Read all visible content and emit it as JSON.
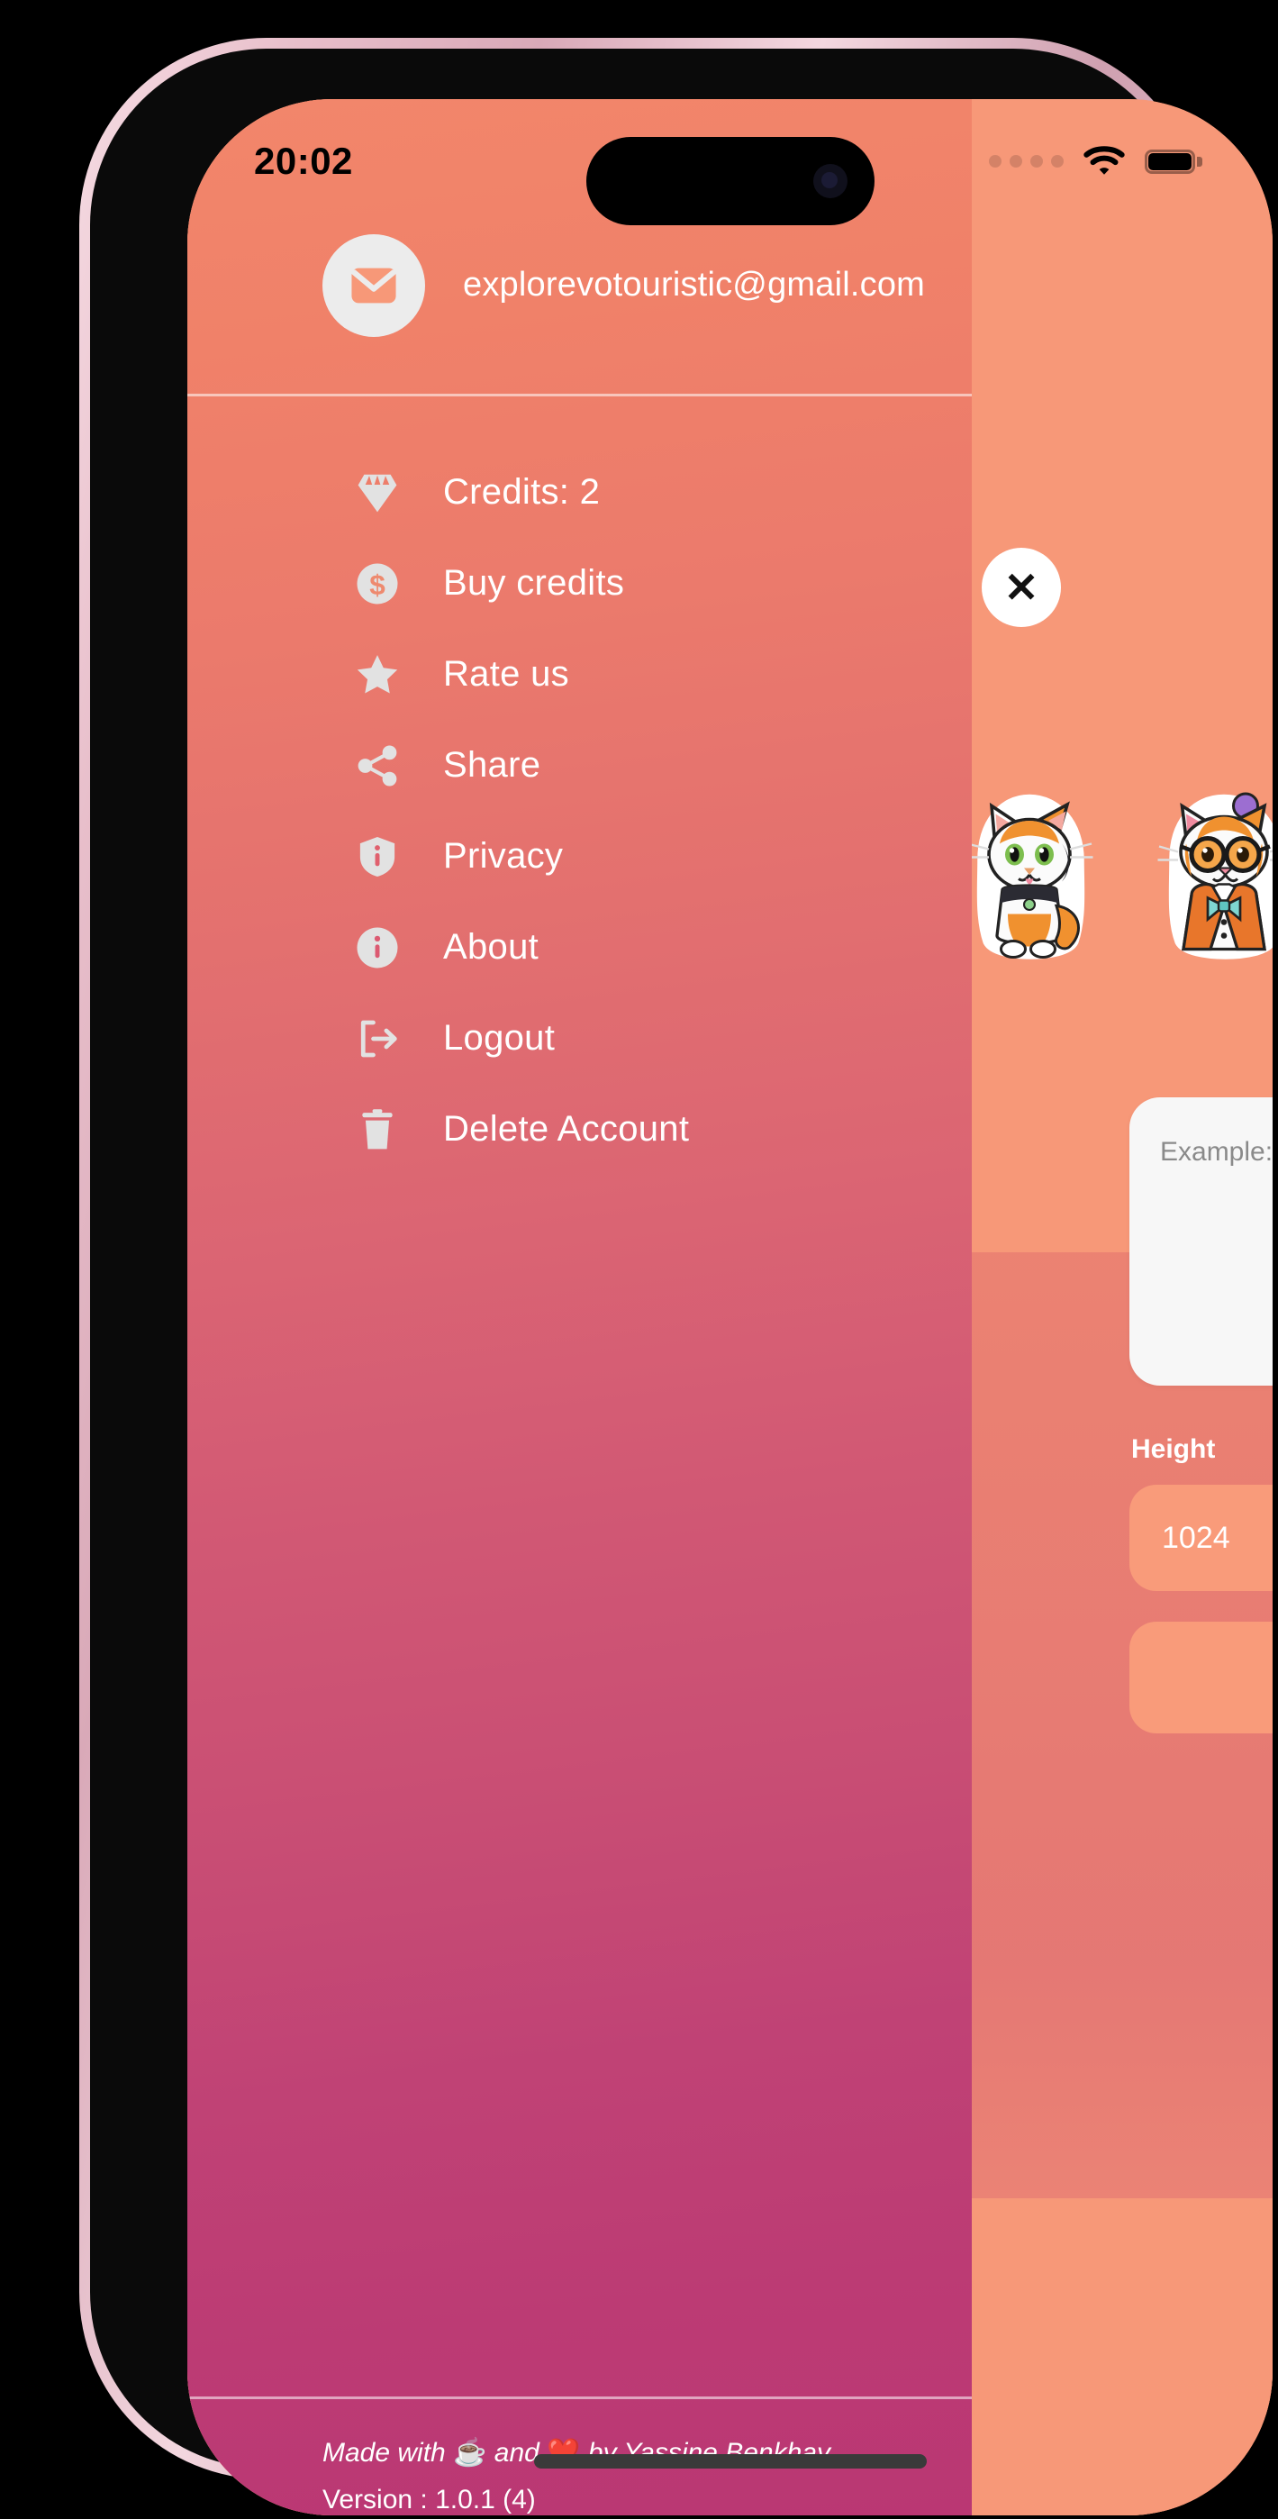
{
  "status_bar": {
    "time": "20:02",
    "signal_icon": "signal-dots-icon",
    "wifi_icon": "wifi-icon",
    "battery_icon": "battery-icon"
  },
  "drawer": {
    "account": {
      "avatar_icon": "envelope-icon",
      "email": "explorevotouristic@gmail.com"
    },
    "items": [
      {
        "label": "Credits: 2",
        "icon": "diamond-icon"
      },
      {
        "label": "Buy credits",
        "icon": "dollar-circle-icon"
      },
      {
        "label": "Rate us",
        "icon": "star-icon"
      },
      {
        "label": "Share",
        "icon": "share-icon"
      },
      {
        "label": "Privacy",
        "icon": "shield-info-icon"
      },
      {
        "label": "About",
        "icon": "info-circle-icon"
      },
      {
        "label": "Logout",
        "icon": "logout-icon"
      },
      {
        "label": "Delete Account",
        "icon": "trash-icon"
      }
    ],
    "footer": {
      "made_with_prefix": "Made with",
      "coffee_emoji": "☕",
      "made_with_middle": "and",
      "heart_emoji": "❤️",
      "made_with_suffix": "by Yassine Benkhay",
      "version": "Version : 1.0.1 (4)"
    }
  },
  "app_background": {
    "close_button_label": "✕",
    "stickers": [
      {
        "name": "calico-cat-sticker"
      },
      {
        "name": "cat-in-suit-with-glasses-sticker"
      }
    ],
    "prompt_input": {
      "placeholder": "Example: a cute p"
    },
    "height_field": {
      "label": "Height",
      "value": "1024"
    }
  },
  "colors": {
    "drawer_top": "#F2866B",
    "drawer_bottom": "#BA3773",
    "app_background": "#F79878",
    "field_fill": "#F99B7A",
    "text_on_drawer": "#FFFFFF"
  }
}
